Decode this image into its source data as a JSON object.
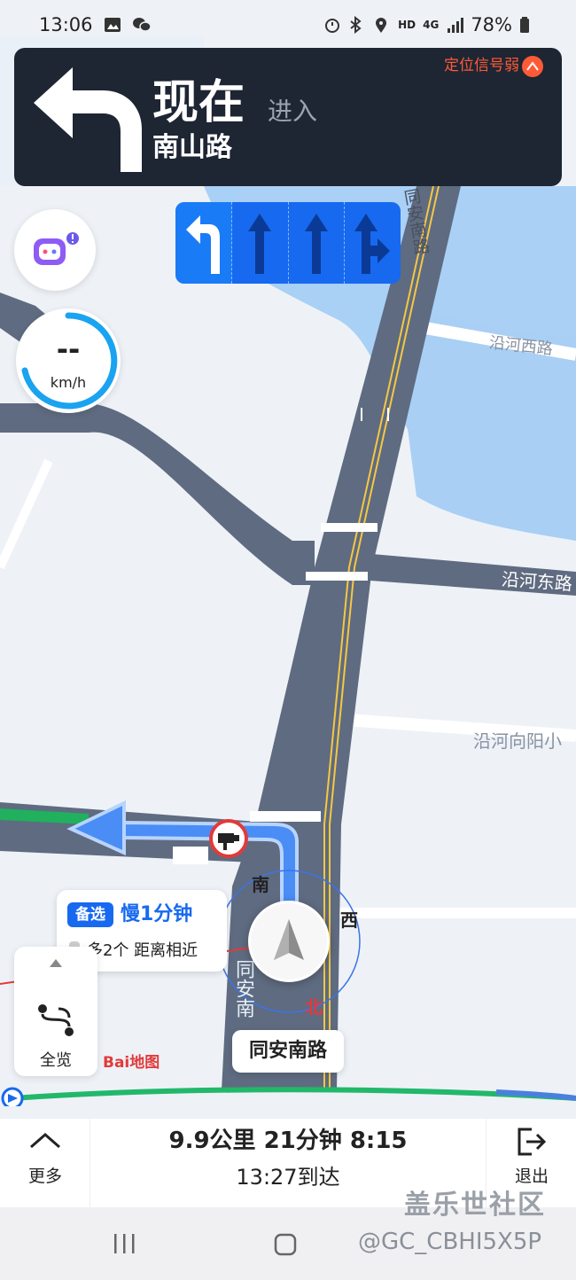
{
  "status_bar": {
    "time": "13:06",
    "battery": "78%",
    "network_label": "4G",
    "hd_label": "HD"
  },
  "banner": {
    "action": "现在",
    "enter": "进入",
    "road": "南山路",
    "gps_warning": "定位信号弱"
  },
  "speed": {
    "value": "--",
    "unit": "km/h"
  },
  "map_labels": {
    "road_tongan_nan_top": "同安南路",
    "yanhe_xi": "沿河西路",
    "yanhe_dong": "沿河东路",
    "yanhe_xiangyang": "沿河向阳小",
    "tongan_nan_vertical": "同安南"
  },
  "compass": {
    "south": "南",
    "west": "西",
    "north": "北"
  },
  "alternative_route": {
    "badge": "备选",
    "title": "慢1分钟",
    "detail": "多2个 距离相近"
  },
  "overview": {
    "label": "全览"
  },
  "logo": "Bai地图",
  "current_road": "同安南路",
  "trip": {
    "summary": "9.9公里 21分钟 8:15",
    "arrival": "13:27到达"
  },
  "bottom": {
    "more_label": "更多",
    "exit_label": "退出"
  },
  "watermark": {
    "line1": "盖乐世社区",
    "line2": "@GC_CBHI5X5P"
  },
  "colors": {
    "route_blue": "#1769f0",
    "progress_green": "#22b86a",
    "banner_bg": "#1e2533",
    "gps_warning": "#ff5a36"
  }
}
